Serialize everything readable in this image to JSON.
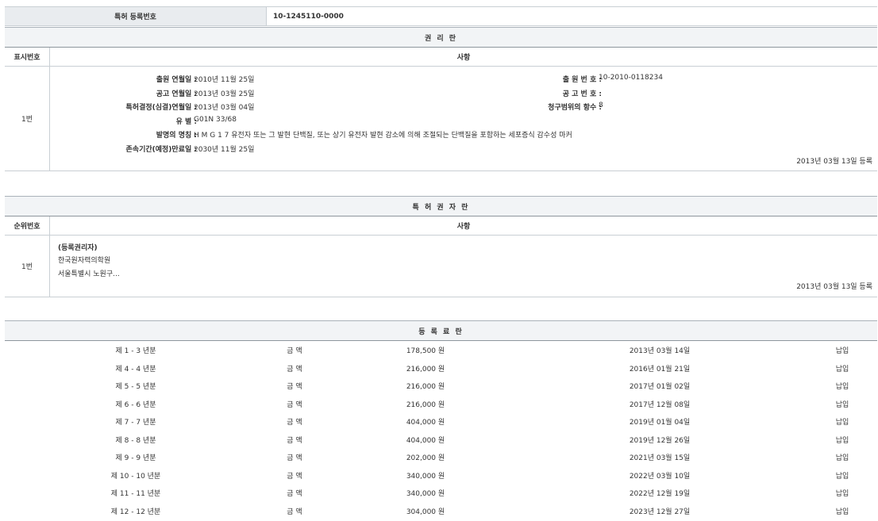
{
  "top": {
    "label": "특허 등록번호",
    "value": "10-1245110-0000"
  },
  "rights": {
    "title": "권 리 란",
    "col1": "표시번호",
    "col2": "사항",
    "row_no": "1번",
    "fields": [
      {
        "label": "출원 연월일 :",
        "value": "2010년 11월 25일"
      },
      {
        "label": "공고 연월일 :",
        "value": "2013년 03월 25일"
      },
      {
        "label": "특허결정(심결)연월일 :",
        "value": "2013년 03월 04일"
      },
      {
        "label": "유 별 :",
        "value": "G01N 33/68"
      },
      {
        "label": "발명의 명칭 :",
        "value": "H M G 1 7 유전자 또는 그 발현 단백질, 또는 상기 유전자 발현 감소에 의해 조절되는 단백질을 포함하는 세포증식 감수성 마커"
      },
      {
        "label": "존속기간(예정)만료일 :",
        "value": "2030년 11월 25일"
      }
    ],
    "right_fields": [
      {
        "label": "출 원 번 호 :",
        "value": "10-2010-0118234"
      },
      {
        "label": "공 고 번 호 :",
        "value": ""
      },
      {
        "label": "청구범위의 항수 :",
        "value": "8"
      }
    ],
    "registered": "2013년 03월 13일 등록"
  },
  "holders": {
    "title": "특 허 권 자 란",
    "col1": "순위번호",
    "col2": "사항",
    "row_no": "1번",
    "lines": [
      "(등록권리자)",
      "한국원자력의학원",
      "서울특별시 노원구..."
    ],
    "registered": "2013년 03월 13일 등록"
  },
  "fees": {
    "title": "등 록 료 란",
    "rows": [
      {
        "period": "제 1 - 3 년분",
        "kind": "금 액",
        "amount": "178,500 원",
        "date": "2013년 03월 14일",
        "status": "납입"
      },
      {
        "period": "제 4 - 4 년분",
        "kind": "금 액",
        "amount": "216,000 원",
        "date": "2016년 01월 21일",
        "status": "납입"
      },
      {
        "period": "제 5 - 5 년분",
        "kind": "금 액",
        "amount": "216,000 원",
        "date": "2017년 01월 02일",
        "status": "납입"
      },
      {
        "period": "제 6 - 6 년분",
        "kind": "금 액",
        "amount": "216,000 원",
        "date": "2017년 12월 08일",
        "status": "납입"
      },
      {
        "period": "제 7 - 7 년분",
        "kind": "금 액",
        "amount": "404,000 원",
        "date": "2019년 01월 04일",
        "status": "납입"
      },
      {
        "period": "제 8 - 8 년분",
        "kind": "금 액",
        "amount": "404,000 원",
        "date": "2019년 12월 26일",
        "status": "납입"
      },
      {
        "period": "제 9 - 9 년분",
        "kind": "금 액",
        "amount": "202,000 원",
        "date": "2021년 03월 15일",
        "status": "납입"
      },
      {
        "period": "제 10 - 10 년분",
        "kind": "금 액",
        "amount": "340,000 원",
        "date": "2022년 03월 10일",
        "status": "납입"
      },
      {
        "period": "제 11 - 11 년분",
        "kind": "금 액",
        "amount": "340,000 원",
        "date": "2022년 12월 19일",
        "status": "납입"
      },
      {
        "period": "제 12 - 12 년분",
        "kind": "금 액",
        "amount": "304,000 원",
        "date": "2023년 12월 27일",
        "status": "납입"
      }
    ]
  }
}
